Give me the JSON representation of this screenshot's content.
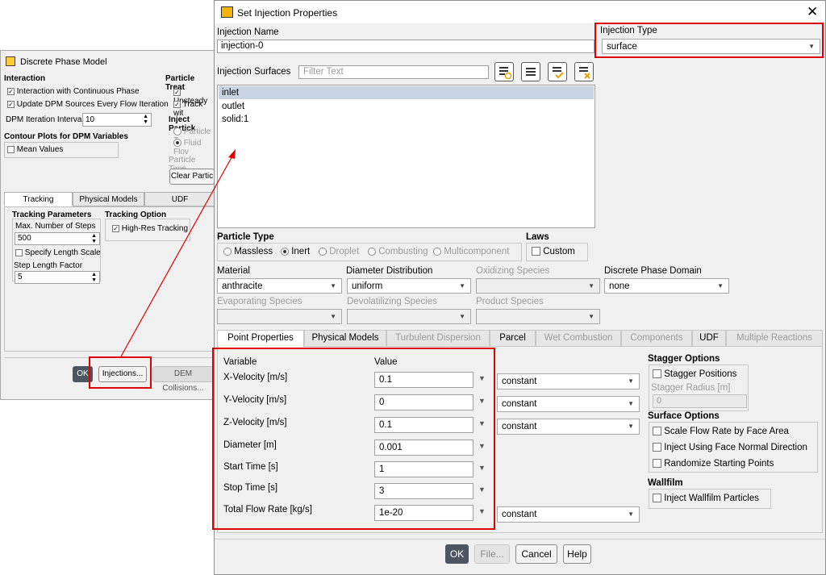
{
  "dpm": {
    "title": "Discrete Phase Model",
    "interaction_header": "Interaction",
    "interaction_continuous": "Interaction with Continuous Phase",
    "update_sources": "Update DPM Sources Every Flow Iteration",
    "iteration_interval_label": "DPM Iteration Interval",
    "iteration_interval_value": "10",
    "contour_header": "Contour Plots for DPM Variables",
    "mean_values": "Mean Values",
    "particle_treat_header": "Particle Treat",
    "unsteady": "Unsteady",
    "track_with": "Track wit",
    "inject_particles": "Inject Partick",
    "particle_t": "Particle T",
    "fluid_flow": "Fluid Flov",
    "particle_time": "Particle Time",
    "clear_particles": "Clear Partic",
    "tabs": [
      "Tracking",
      "Physical Models",
      "UDF"
    ],
    "tracking_params_header": "Tracking Parameters",
    "max_steps_label": "Max. Number of Steps",
    "max_steps_value": "500",
    "specify_length_scale": "Specify Length Scale",
    "step_length_factor_label": "Step Length Factor",
    "step_length_factor_value": "5",
    "tracking_option_header": "Tracking Option",
    "high_res_tracking": "High-Res Tracking",
    "ok": "OK",
    "injections": "Injections...",
    "dem_collisions": "DEM Collisions..."
  },
  "dialog": {
    "title": "Set Injection Properties",
    "injection_name_label": "Injection Name",
    "injection_name_value": "injection-0",
    "injection_type_label": "Injection Type",
    "injection_type_value": "surface",
    "injection_surfaces_label": "Injection Surfaces",
    "filter_placeholder": "Filter Text",
    "surfaces": [
      "inlet",
      "outlet",
      "solid:1"
    ],
    "particle_type_label": "Particle Type",
    "particle_types": [
      "Massless",
      "Inert",
      "Droplet",
      "Combusting",
      "Multicomponent"
    ],
    "laws_label": "Laws",
    "custom_label": "Custom",
    "material_label": "Material",
    "material_value": "anthracite",
    "diameter_dist_label": "Diameter Distribution",
    "diameter_dist_value": "uniform",
    "oxidizing_label": "Oxidizing Species",
    "domain_label": "Discrete Phase Domain",
    "domain_value": "none",
    "evaporating_label": "Evaporating Species",
    "devolatilizing_label": "Devolatilizing Species",
    "product_label": "Product Species",
    "tabs": [
      "Point Properties",
      "Physical Models",
      "Turbulent Dispersion",
      "Parcel",
      "Wet Combustion",
      "Components",
      "UDF",
      "Multiple Reactions"
    ],
    "variable_header": "Variable",
    "value_header": "Value",
    "variables": [
      {
        "name": "X-Velocity [m/s]",
        "value": "0.1",
        "profile": "constant"
      },
      {
        "name": "Y-Velocity [m/s]",
        "value": "0",
        "profile": "constant"
      },
      {
        "name": "Z-Velocity [m/s]",
        "value": "0.1",
        "profile": "constant"
      },
      {
        "name": "Diameter [m]",
        "value": "0.001",
        "profile": ""
      },
      {
        "name": "Start Time [s]",
        "value": "1",
        "profile": ""
      },
      {
        "name": "Stop Time [s]",
        "value": "3",
        "profile": ""
      },
      {
        "name": "Total Flow Rate [kg/s]",
        "value": "1e-20",
        "profile": "constant"
      }
    ],
    "stagger_header": "Stagger Options",
    "stagger_positions": "Stagger Positions",
    "stagger_radius_label": "Stagger Radius [m]",
    "stagger_radius_value": "0",
    "surface_options_header": "Surface Options",
    "scale_flow_rate": "Scale Flow Rate by Face Area",
    "inject_face_normal": "Inject Using Face Normal Direction",
    "randomize_points": "Randomize Starting Points",
    "wallfilm_header": "Wallfilm",
    "inject_wallfilm": "Inject Wallfilm Particles",
    "ok": "OK",
    "file": "File...",
    "cancel": "Cancel",
    "help": "Help"
  },
  "colors": {
    "highlight_red": "#e00000",
    "selected_row": "#c8d4e4"
  }
}
